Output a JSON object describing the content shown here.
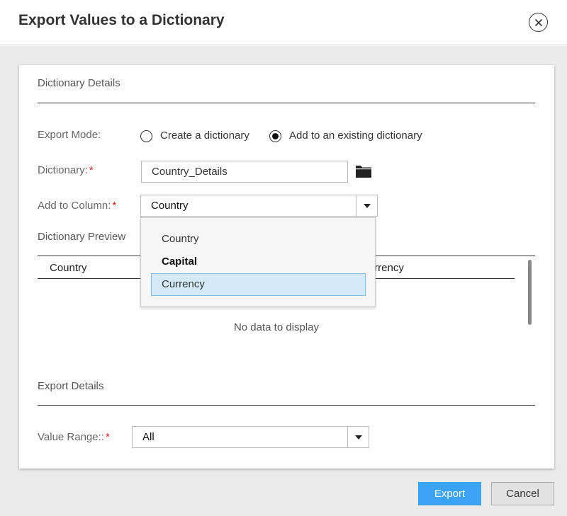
{
  "dialog": {
    "title": "Export Values to a Dictionary"
  },
  "dictionary_details": {
    "heading": "Dictionary Details",
    "export_mode_label": "Export Mode:",
    "export_mode_options": [
      {
        "label": "Create a dictionary",
        "selected": false
      },
      {
        "label": "Add to an existing dictionary",
        "selected": true
      }
    ],
    "dictionary_label": "Dictionary:",
    "dictionary_value": "Country_Details",
    "add_to_column_label": "Add to Column:",
    "add_to_column_value": "Country",
    "required_mark": "*"
  },
  "column_dropdown": {
    "options": [
      "Country",
      "Capital",
      "Currency"
    ],
    "highlighted": "Currency"
  },
  "preview": {
    "heading": "Dictionary Preview",
    "columns": [
      "Country",
      "Currency"
    ],
    "empty_text": "No data to display"
  },
  "export_details": {
    "heading": "Export Details",
    "value_range_label": "Value Range::",
    "value_range_value": "All"
  },
  "footer": {
    "export_label": "Export",
    "cancel_label": "Cancel"
  },
  "colors": {
    "primary": "#3ba3f4",
    "required": "#d42020",
    "highlight": "#d5eaf8"
  },
  "icons": [
    "close-icon",
    "folder-icon",
    "dropdown-arrow-icon"
  ]
}
